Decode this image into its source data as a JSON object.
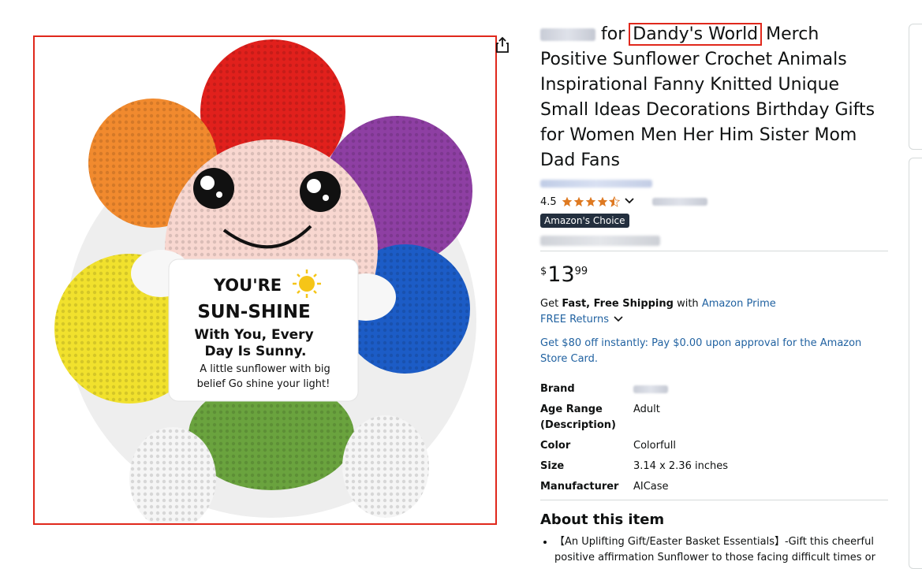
{
  "product": {
    "title_suffix": " Merch Positive Sunflower Crochet Animals Inspirational Fanny Knitted Unique Small Ideas Decorations Birthday Gifts for Women Men Her Him Sister Mom Dad Fans",
    "title_for": "for",
    "title_highlight": "Dandy's World",
    "rating_value": "4.5",
    "rating": 4.5,
    "badge": "Amazon's Choice",
    "price": {
      "symbol": "$",
      "whole": "13",
      "fraction": "99"
    },
    "shipping": {
      "prefix": "Get",
      "bold": "Fast, Free Shipping",
      "with": "with",
      "prime": "Amazon Prime"
    },
    "returns": "FREE Returns",
    "offer": "Get $80 off instantly: Pay $0.00 upon approval for the Amazon Store Card.",
    "specs": [
      {
        "key": "Brand",
        "value": ""
      },
      {
        "key": "Age Range (Description)",
        "value": "Adult"
      },
      {
        "key": "Color",
        "value": "Colorfull"
      },
      {
        "key": "Size",
        "value": "3.14 x 2.36 inches"
      },
      {
        "key": "Manufacturer",
        "value": "AICase"
      }
    ],
    "about_heading": "About this item",
    "bullets": [
      "【An Uplifting Gift/Easter Basket Essentials】-Gift this cheerful positive affirmation Sunflower to those facing difficult times or"
    ]
  },
  "image": {
    "card_line1": "YOU'RE",
    "card_line2": "SUN-SHINE",
    "card_line3": "With You, Every",
    "card_line4": "Day Is Sunny.",
    "card_line5": "A little sunflower with big",
    "card_line6": "belief Go shine your light!"
  },
  "colors": {
    "star": "#de7921",
    "link": "#2162a1",
    "highlight": "#e0281c",
    "badge": "#232f3e"
  }
}
